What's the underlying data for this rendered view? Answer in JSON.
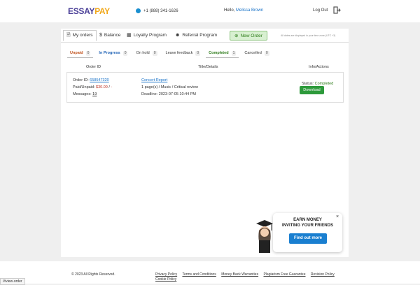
{
  "header": {
    "logo_part1": "ESSAY",
    "logo_part2": "PAY",
    "phone": "+1 (888) 341-1626",
    "greeting": "Hello,",
    "user_name": "Melissa Brown",
    "logout_label": "Log Out"
  },
  "tabs": {
    "my_orders": "My orders",
    "balance": "Balance",
    "loyalty": "Loyalty Program",
    "referral": "Referral Program",
    "new_order": "New Order",
    "timezone_note": "All dates are displayed in your time zone (UTC +3)"
  },
  "status_tabs": [
    {
      "label": "Unpaid",
      "count": "0"
    },
    {
      "label": "In Progress",
      "count": "0"
    },
    {
      "label": "On hold",
      "count": "0"
    },
    {
      "label": "Leave feedback",
      "count": "0"
    },
    {
      "label": "Completed",
      "count": "1"
    },
    {
      "label": "Cancelled",
      "count": "0"
    }
  ],
  "table": {
    "headers": [
      "Order ID",
      "Title/Details",
      "Info/Actions"
    ],
    "order": {
      "id_label": "Order ID:",
      "id": "658547320",
      "paid_label": "Paid/Unpaid:",
      "paid_amount": "$30.00",
      "unpaid_amount": "-",
      "messages_label": "Messages:",
      "messages_count": "19",
      "title": "Concert Report",
      "details": "1 page(s) / Music / Critical review",
      "deadline": "Deadline: 2023-07-05 10:44 PM",
      "status_label": "Status:",
      "status_value": "Completed",
      "download_label": "Download"
    }
  },
  "promo": {
    "line1": "EARN MONEY",
    "line2": "INVITING YOUR FRIENDS",
    "button": "Find out more",
    "close": "×"
  },
  "footer": {
    "copyright": "© 2023 All Rights Reserved.",
    "links": [
      "Privacy Policy",
      "Terms and Conditions",
      "Money Back Warranties",
      "Plagiarism Free Guarantee",
      "Revision Policy"
    ],
    "cookie": "Cookie Policy"
  },
  "statusbar_url": "/#view-order"
}
